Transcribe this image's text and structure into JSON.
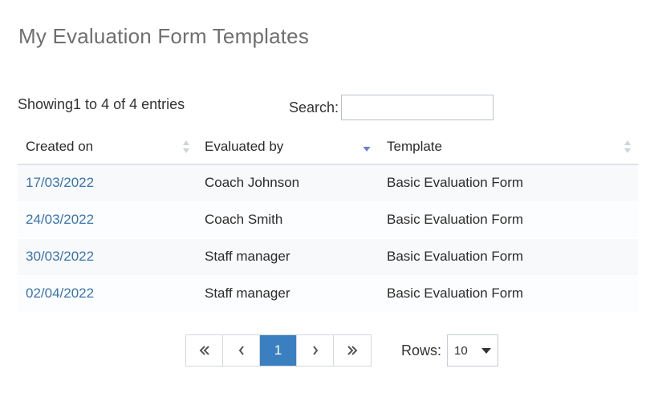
{
  "page": {
    "title": "My Evaluation Form Templates"
  },
  "info": {
    "text": "Showing1 to 4 of 4 entries"
  },
  "search": {
    "label": "Search:",
    "value": "",
    "placeholder": ""
  },
  "table": {
    "columns": [
      {
        "label": "Created on",
        "sort": "none"
      },
      {
        "label": "Evaluated by",
        "sort": "descending"
      },
      {
        "label": "Template",
        "sort": "none"
      }
    ],
    "rows": [
      {
        "created_on": "17/03/2022",
        "evaluated_by": "Coach Johnson",
        "template": "Basic Evaluation Form"
      },
      {
        "created_on": "24/03/2022",
        "evaluated_by": "Coach Smith",
        "template": "Basic Evaluation Form"
      },
      {
        "created_on": "30/03/2022",
        "evaluated_by": "Staff manager",
        "template": "Basic Evaluation Form"
      },
      {
        "created_on": "02/04/2022",
        "evaluated_by": "Staff manager",
        "template": "Basic Evaluation Form"
      }
    ]
  },
  "pagination": {
    "first": "«",
    "prev": "‹",
    "current": "1",
    "next": "›",
    "last": "»"
  },
  "rows_per_page": {
    "label": "Rows:",
    "value": "10"
  },
  "colors": {
    "link": "#3a74ad",
    "active_page": "#3a7fc0",
    "sort_active": "#6b7fd6",
    "sort_inactive": "#cfd4d9"
  }
}
